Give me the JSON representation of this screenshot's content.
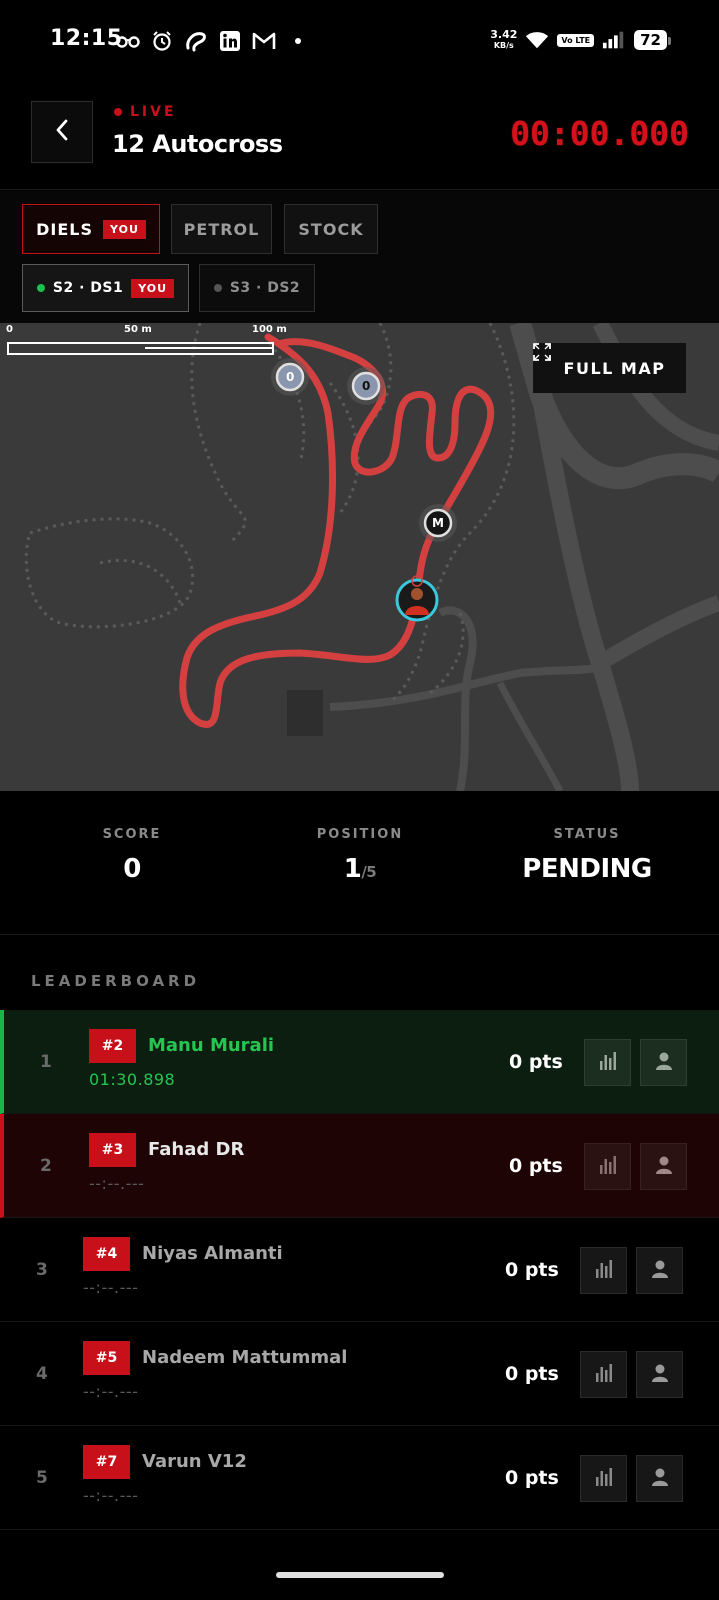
{
  "status_bar": {
    "time": "12:15",
    "speed_value": "3.42",
    "speed_unit": "KB/s",
    "volte": "Vo LTE",
    "battery": "72",
    "icons": [
      "glasses-icon",
      "alarm-icon",
      "airtel-icon",
      "linkedin-icon",
      "gmail-icon",
      "dot-icon",
      "wifi-icon",
      "signal-icon"
    ]
  },
  "header": {
    "live_label": "LIVE",
    "title": "12 Autocross",
    "timer": "00:00.000"
  },
  "class_tabs": [
    {
      "label": "DIELS",
      "badge": "YOU",
      "active": true
    },
    {
      "label": "PETROL",
      "active": false
    },
    {
      "label": "STOCK",
      "active": false
    }
  ],
  "session_tabs": [
    {
      "label": "S2 · DS1",
      "badge": "YOU",
      "dot_color": "#19c24c",
      "active": true
    },
    {
      "label": "S3 · DS2",
      "dot_color": "#555555",
      "active": false
    }
  ],
  "map": {
    "scale_labels": [
      "0",
      "50 m",
      "100 m"
    ],
    "full_map_label": "FULL MAP",
    "markers": [
      "0",
      "0",
      "M"
    ],
    "track_color": "#d23c3c"
  },
  "stats": {
    "score_label": "SCORE",
    "score_value": "0",
    "position_label": "POSITION",
    "position_value": "1",
    "position_total": "/5",
    "status_label": "STATUS",
    "status_value": "PENDING"
  },
  "leaderboard": {
    "title": "LEADERBOARD",
    "rows": [
      {
        "pos": "1",
        "num": "#2",
        "name": "Manu Murali",
        "time": "01:30.898",
        "pts": "0 pts"
      },
      {
        "pos": "2",
        "num": "#3",
        "name": "Fahad DR",
        "time": "--:--.---",
        "pts": "0 pts"
      },
      {
        "pos": "3",
        "num": "#4",
        "name": "Niyas Almanti",
        "time": "--:--.---",
        "pts": "0 pts"
      },
      {
        "pos": "4",
        "num": "#5",
        "name": "Nadeem Mattummal",
        "time": "--:--.---",
        "pts": "0 pts"
      },
      {
        "pos": "5",
        "num": "#7",
        "name": "Varun V12",
        "time": "--:--.---",
        "pts": "0 pts"
      }
    ]
  },
  "colors": {
    "accent_red": "#c8101a",
    "leader_green": "#26c552"
  }
}
